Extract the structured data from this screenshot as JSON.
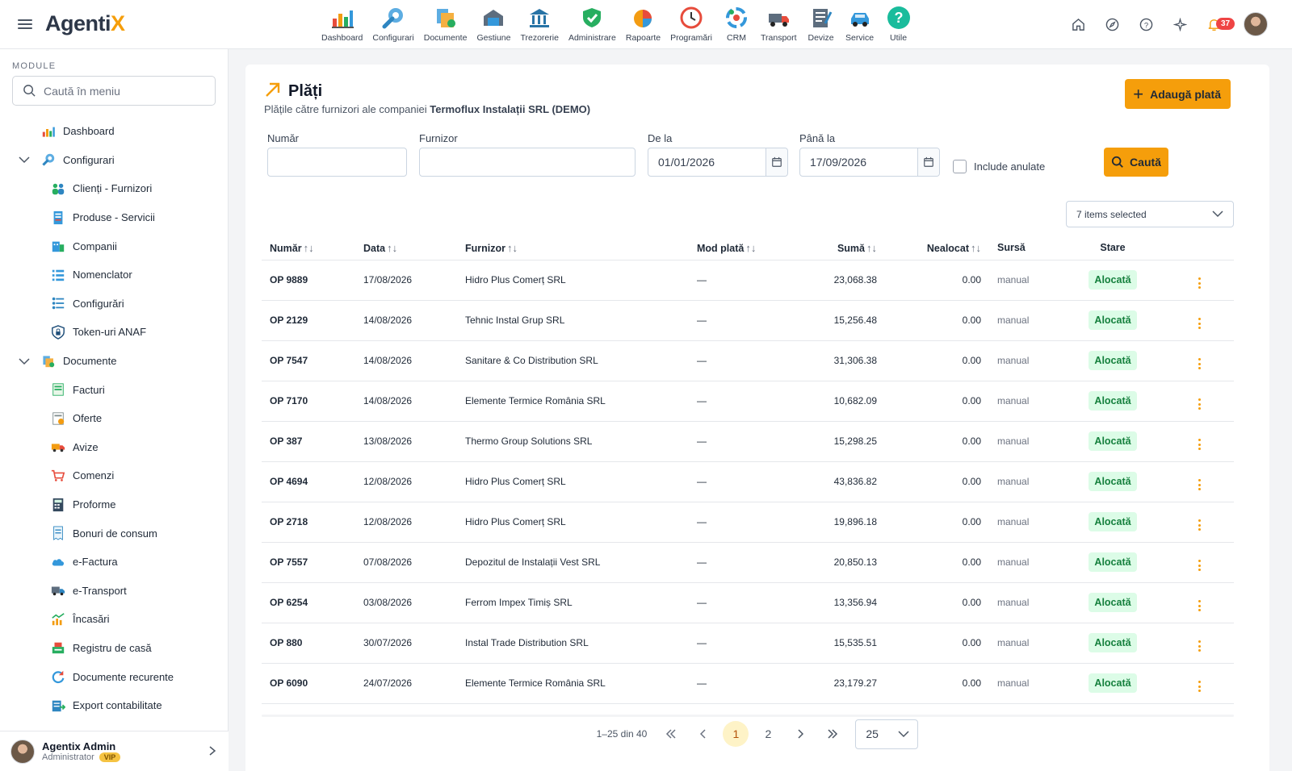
{
  "app": {
    "logo_main": "Agenti",
    "logo_accent": "X"
  },
  "modules": [
    {
      "label": "Dashboard",
      "icon": "dashboard-chart-icon"
    },
    {
      "label": "Configurari",
      "icon": "wrench-gear-icon"
    },
    {
      "label": "Documente",
      "icon": "documents-icon"
    },
    {
      "label": "Gestiune",
      "icon": "warehouse-icon"
    },
    {
      "label": "Trezorerie",
      "icon": "bank-icon"
    },
    {
      "label": "Administrare",
      "icon": "shield-check-icon"
    },
    {
      "label": "Rapoarte",
      "icon": "pie-chart-icon"
    },
    {
      "label": "Programări",
      "icon": "clock-icon"
    },
    {
      "label": "CRM",
      "icon": "crm-icon"
    },
    {
      "label": "Transport",
      "icon": "truck-icon"
    },
    {
      "label": "Devize",
      "icon": "estimate-icon"
    },
    {
      "label": "Service",
      "icon": "car-service-icon"
    },
    {
      "label": "Utile",
      "icon": "help-circle-icon"
    }
  ],
  "header": {
    "notifications": "37"
  },
  "sidebar": {
    "section_label": "MODULE",
    "search_placeholder": "Caută în meniu",
    "items": [
      {
        "label": "Dashboard"
      },
      {
        "label": "Configurari"
      },
      {
        "label": "Clienți - Furnizori"
      },
      {
        "label": "Produse - Servicii"
      },
      {
        "label": "Companii"
      },
      {
        "label": "Nomenclator"
      },
      {
        "label": "Configurări"
      },
      {
        "label": "Token-uri ANAF"
      },
      {
        "label": "Documente"
      },
      {
        "label": "Facturi"
      },
      {
        "label": "Oferte"
      },
      {
        "label": "Avize"
      },
      {
        "label": "Comenzi"
      },
      {
        "label": "Proforme"
      },
      {
        "label": "Bonuri de consum"
      },
      {
        "label": "e-Factura"
      },
      {
        "label": "e-Transport"
      },
      {
        "label": "Încasări"
      },
      {
        "label": "Registru de casă"
      },
      {
        "label": "Documente recurente"
      },
      {
        "label": "Export contabilitate"
      }
    ],
    "user": {
      "name": "Agentix Admin",
      "role": "Administrator",
      "badge": "VIP"
    }
  },
  "page": {
    "title": "Plăți",
    "subtitle_prefix": "Plățile către furnizori ale companiei",
    "company": "Termoflux Instalații SRL (DEMO)",
    "add_button": "Adaugă plată"
  },
  "filters": {
    "numar_label": "Număr",
    "numar_value": "",
    "furnizor_label": "Furnizor",
    "furnizor_value": "",
    "from_label": "De la",
    "from_value": "01/01/2026",
    "to_label": "Până la",
    "to_value": "17/09/2026",
    "include_label": "Include anulate",
    "search_button": "Caută",
    "columns_select": "7 items selected"
  },
  "table": {
    "headers": {
      "numar": "Număr",
      "data": "Data",
      "furnizor": "Furnizor",
      "mod": "Mod plată",
      "suma": "Sumă",
      "nealocat": "Nealocat",
      "sursa": "Sursă",
      "stare": "Stare"
    },
    "rows": [
      {
        "numar": "OP 9889",
        "data": "17/08/2026",
        "furnizor": "Hidro Plus Comerț SRL",
        "mod": "—",
        "suma": "23,068.38",
        "nealocat": "0.00",
        "sursa": "manual",
        "stare": "Alocată"
      },
      {
        "numar": "OP 2129",
        "data": "14/08/2026",
        "furnizor": "Tehnic Instal Grup SRL",
        "mod": "—",
        "suma": "15,256.48",
        "nealocat": "0.00",
        "sursa": "manual",
        "stare": "Alocată"
      },
      {
        "numar": "OP 7547",
        "data": "14/08/2026",
        "furnizor": "Sanitare & Co Distribution SRL",
        "mod": "—",
        "suma": "31,306.38",
        "nealocat": "0.00",
        "sursa": "manual",
        "stare": "Alocată"
      },
      {
        "numar": "OP 7170",
        "data": "14/08/2026",
        "furnizor": "Elemente Termice România SRL",
        "mod": "—",
        "suma": "10,682.09",
        "nealocat": "0.00",
        "sursa": "manual",
        "stare": "Alocată"
      },
      {
        "numar": "OP 387",
        "data": "13/08/2026",
        "furnizor": "Thermo Group Solutions SRL",
        "mod": "—",
        "suma": "15,298.25",
        "nealocat": "0.00",
        "sursa": "manual",
        "stare": "Alocată"
      },
      {
        "numar": "OP 4694",
        "data": "12/08/2026",
        "furnizor": "Hidro Plus Comerț SRL",
        "mod": "—",
        "suma": "43,836.82",
        "nealocat": "0.00",
        "sursa": "manual",
        "stare": "Alocată"
      },
      {
        "numar": "OP 2718",
        "data": "12/08/2026",
        "furnizor": "Hidro Plus Comerț SRL",
        "mod": "—",
        "suma": "19,896.18",
        "nealocat": "0.00",
        "sursa": "manual",
        "stare": "Alocată"
      },
      {
        "numar": "OP 7557",
        "data": "07/08/2026",
        "furnizor": "Depozitul de Instalații Vest SRL",
        "mod": "—",
        "suma": "20,850.13",
        "nealocat": "0.00",
        "sursa": "manual",
        "stare": "Alocată"
      },
      {
        "numar": "OP 6254",
        "data": "03/08/2026",
        "furnizor": "Ferrom Impex Timiș SRL",
        "mod": "—",
        "suma": "13,356.94",
        "nealocat": "0.00",
        "sursa": "manual",
        "stare": "Alocată"
      },
      {
        "numar": "OP 880",
        "data": "30/07/2026",
        "furnizor": "Instal Trade Distribution SRL",
        "mod": "—",
        "suma": "15,535.51",
        "nealocat": "0.00",
        "sursa": "manual",
        "stare": "Alocată"
      },
      {
        "numar": "OP 6090",
        "data": "24/07/2026",
        "furnizor": "Elemente Termice România SRL",
        "mod": "—",
        "suma": "23,179.27",
        "nealocat": "0.00",
        "sursa": "manual",
        "stare": "Alocată"
      }
    ]
  },
  "pagination": {
    "range": "1–25 din 40",
    "page1": "1",
    "page2": "2",
    "per_page": "25"
  }
}
